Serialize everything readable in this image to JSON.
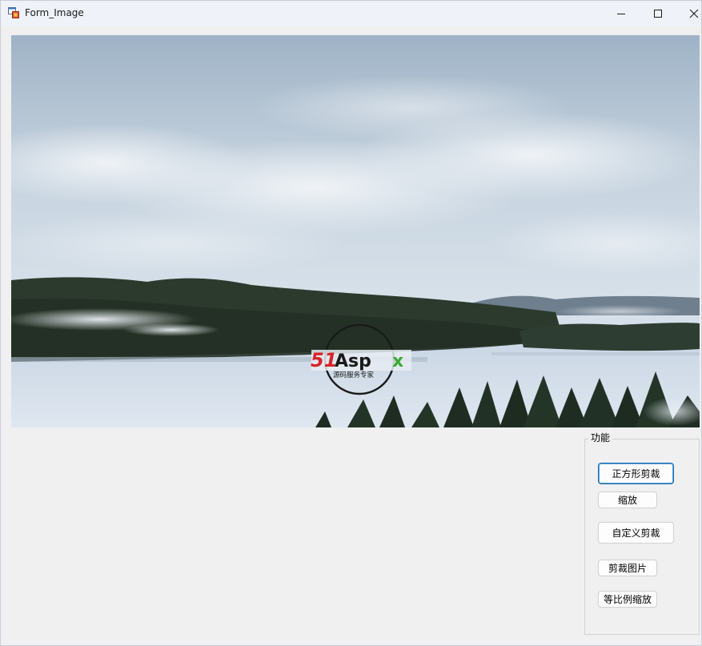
{
  "window": {
    "title": "Form_Image",
    "icon": "form-app-icon",
    "controls": [
      "minimize-icon",
      "maximize-icon",
      "close-icon"
    ]
  },
  "picture": {
    "logo_text_red": "51",
    "logo_text_black": "Asp",
    "logo_text_green": "x",
    "logo_subtitle": "源码服务专家"
  },
  "functions": {
    "group_label": "功能",
    "buttons": {
      "square_crop": "正方形剪裁",
      "zoom": "缩放",
      "custom_crop": "自定义剪裁",
      "crop_image": "剪裁图片",
      "proportional_zoom": "等比例缩放"
    }
  },
  "colors": {
    "accent": "#1e6fb4",
    "logo_red": "#d9232b",
    "logo_green": "#3aaa35"
  }
}
